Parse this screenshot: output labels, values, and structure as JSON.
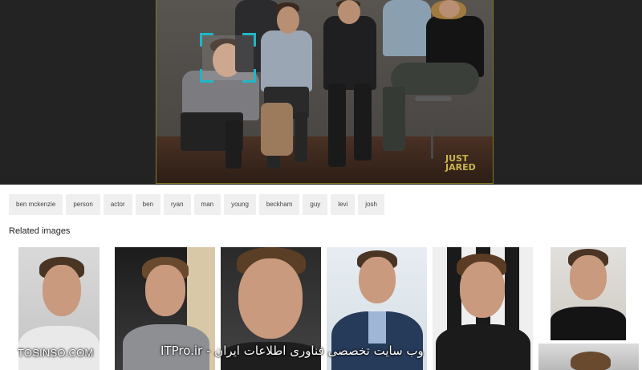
{
  "tags": [
    "ben mckenzie",
    "person",
    "actor",
    "ben",
    "ryan",
    "man",
    "young",
    "beckham",
    "guy",
    "levi",
    "josh"
  ],
  "related_title": "Related images",
  "photo_watermark": "JUST JARED",
  "overlay": {
    "left": "TOSINSO.COM",
    "right": "ITPro.ir - وب سایت تخصصی فناوری اطلاعات ایران"
  },
  "colors": {
    "face_box": "#1fb7c5",
    "viewer_bg": "#232323",
    "tag_bg": "#efefef"
  }
}
